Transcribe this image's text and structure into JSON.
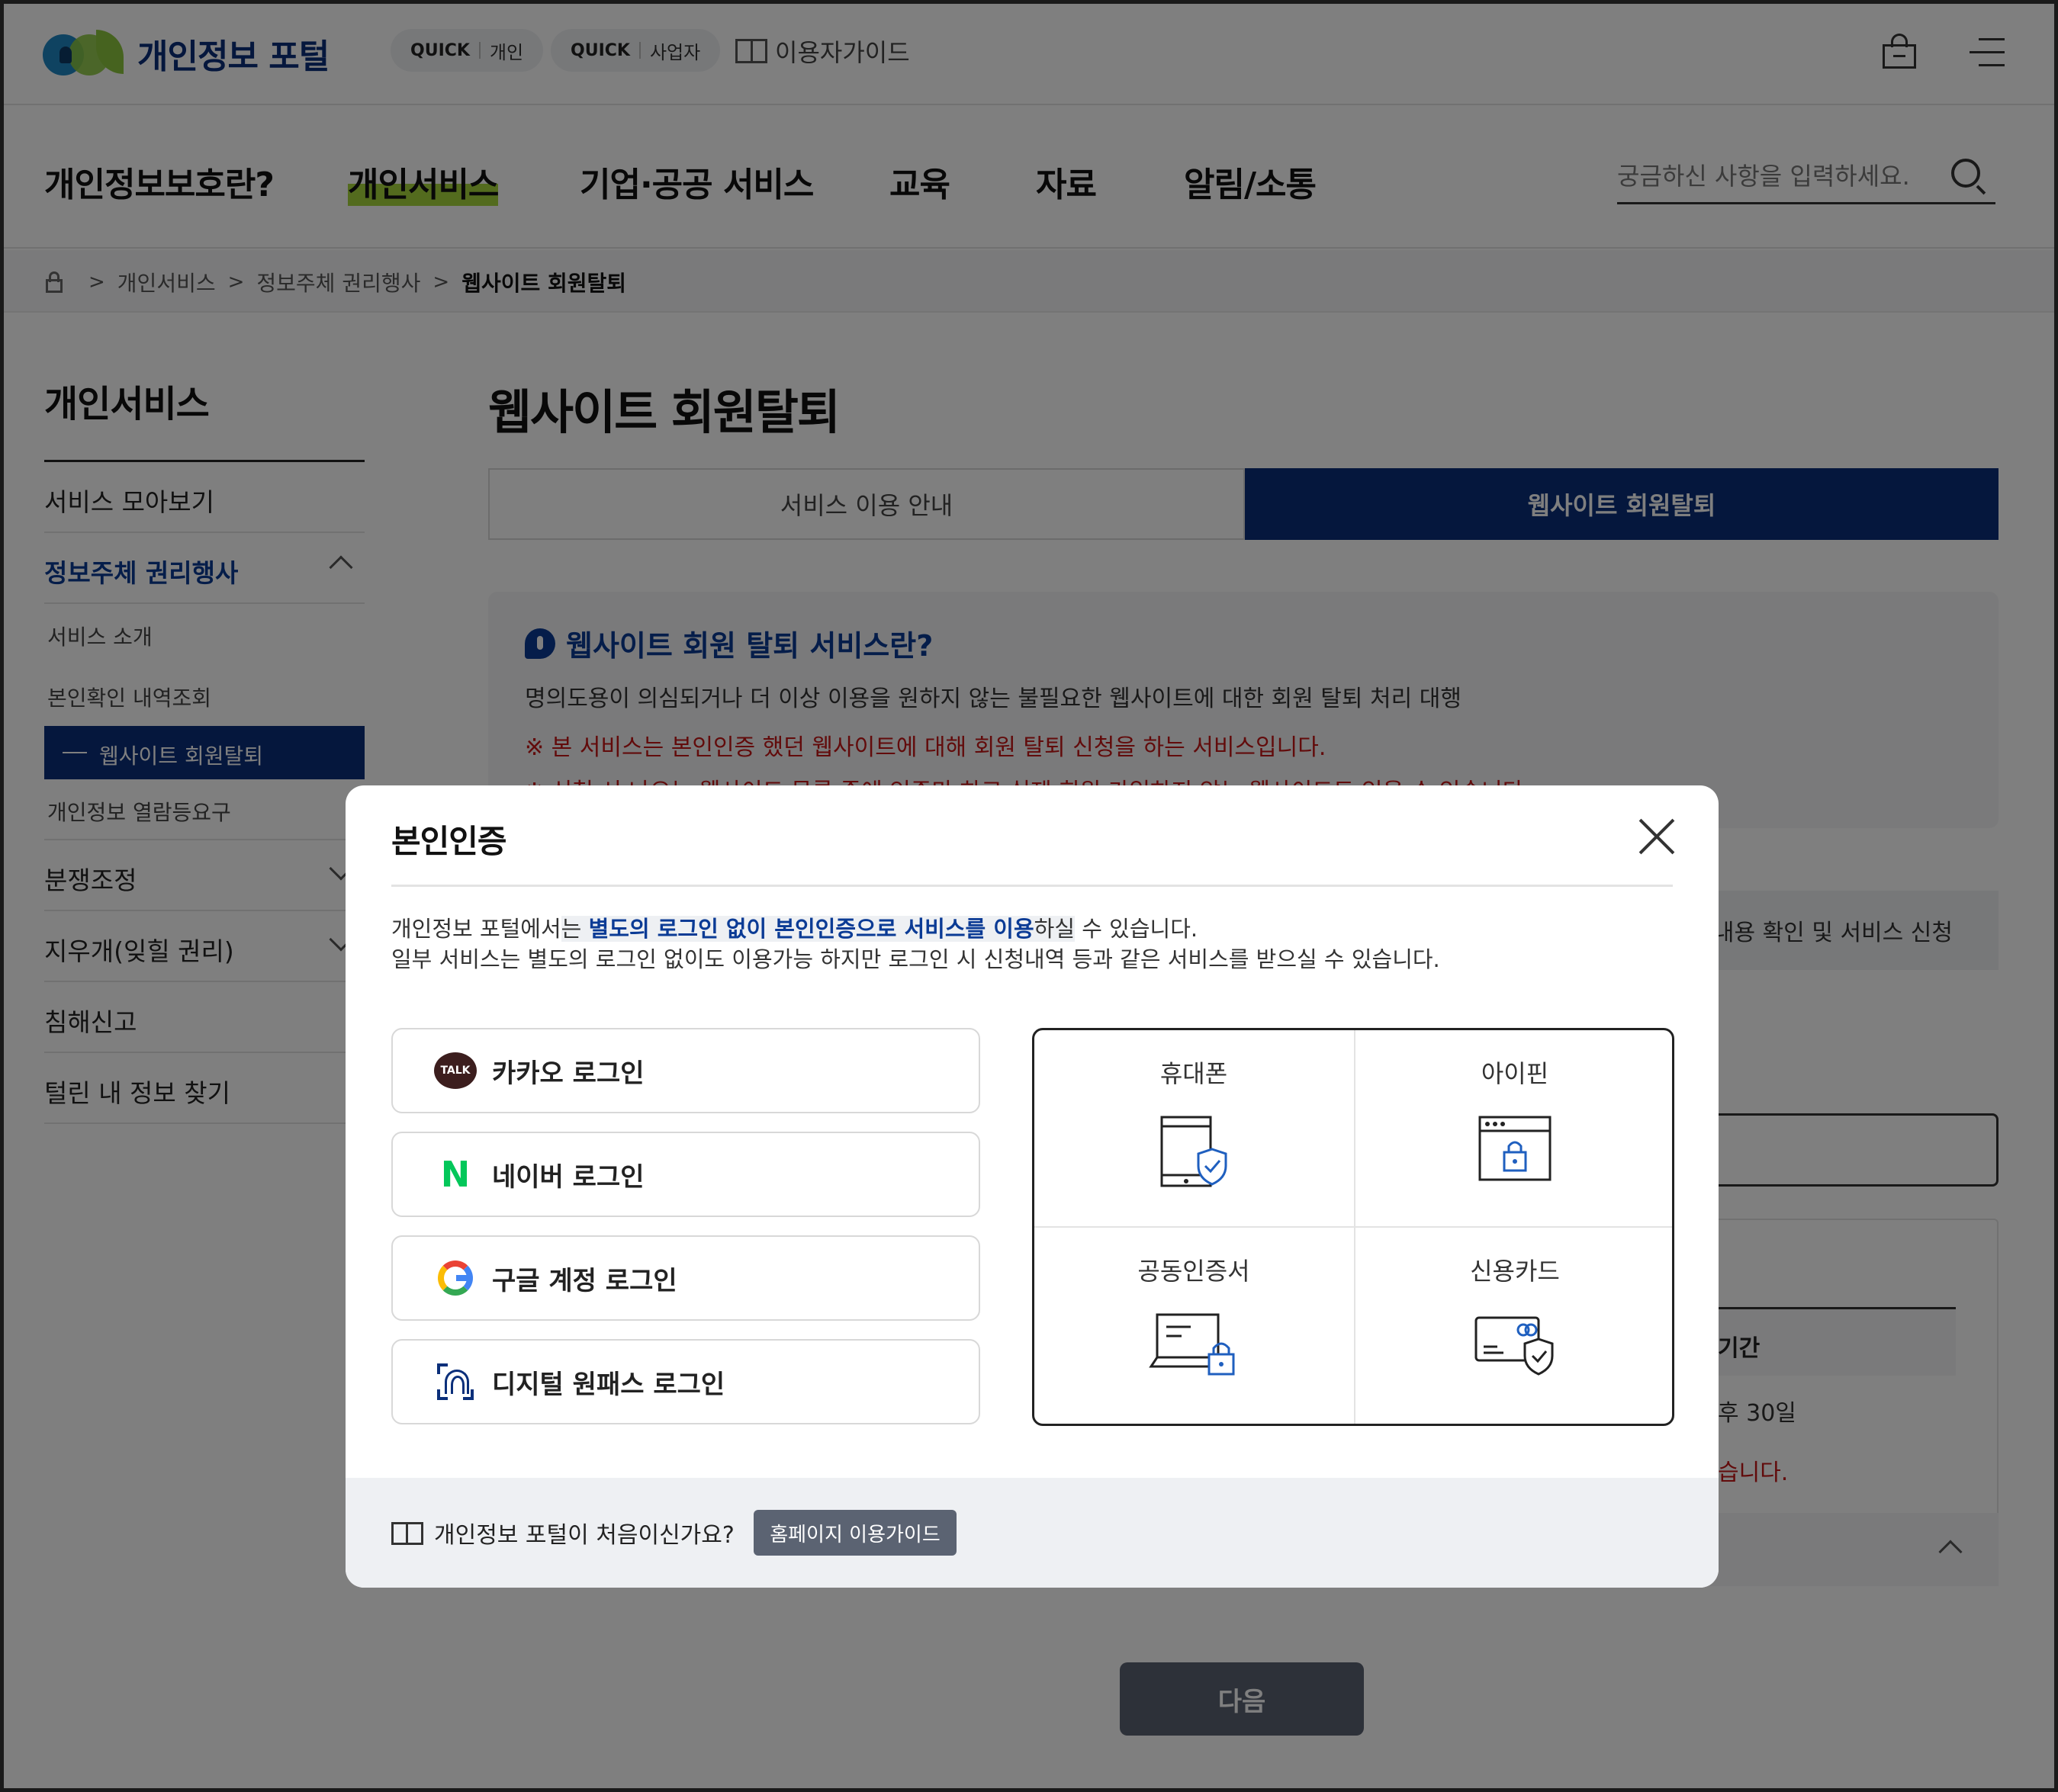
{
  "header": {
    "logo_text": "개인정보 포털",
    "quick_label": "QUICK",
    "quick_personal": "개인",
    "quick_business": "사업자",
    "user_guide": "이용자가이드"
  },
  "gnb": {
    "items": [
      "개인정보보호란?",
      "개인서비스",
      "기업·공공 서비스",
      "교육",
      "자료",
      "알림/소통"
    ],
    "search_placeholder": "궁금하신 사항을 입력하세요."
  },
  "breadcrumb": [
    "개인서비스",
    "정보주체 권리행사",
    "웹사이트 회원탈퇴"
  ],
  "lnb": {
    "title": "개인서비스",
    "items": {
      "all": "서비스 모아보기",
      "rights": "정보주체 권리행사",
      "sub_intro": "서비스 소개",
      "sub_history": "본인확인 내역조회",
      "sub_withdraw": "웹사이트 회원탈퇴",
      "sub_request": "개인정보 열람등요구",
      "dispute": "분쟁조정",
      "forget": "지우개(잊힐 권리)",
      "report": "침해신고",
      "leaked": "털린 내 정보 찾기"
    }
  },
  "main": {
    "title": "웹사이트 회원탈퇴",
    "tab_guide": "서비스 이용 안내",
    "tab_withdraw": "웹사이트 회원탈퇴",
    "info_title": "웹사이트 회원 탈퇴 서비스란?",
    "info_desc": "명의도용이 의심되거나 더 이상 이용을 원하지 않는 불필요한 웹사이트에 대한 회원 탈퇴 처리 대행",
    "info_warn1": "※ 본 서비스는 본인인증 했던 웹사이트에 대해 회원 탈퇴 신청을 하는 서비스입니다.",
    "info_warn2": "※ 신청 시 나오는 웹사이트 목록 중에 인증만 하고 실제 회원 가입하지 않는 웹사이트도 있을 수 있습니다.",
    "step_label": "내용 확인 및 서비스 신청",
    "table_head": "기간",
    "table_cell": "후 30일",
    "table_warn": "습니다.",
    "next": "다음"
  },
  "modal": {
    "title": "본인인증",
    "desc_pre": "개인정보 포털에서",
    "desc_hl_pre": "는 ",
    "desc_hl_blue": "별도의 로그인 없이 본인인증으로 서비스를 이용",
    "desc_hl_post": "하실",
    "desc_post": " 수 있습니다.",
    "desc_line2": "일부 서비스는 별도의 로그인 없이도 이용가능 하지만 로그인 시 신청내역 등과 같은 서비스를 받으실 수 있습니다.",
    "kakao_icon_text": "TALK",
    "naver_icon_text": "N",
    "logins": {
      "kakao": "카카오 로그인",
      "naver": "네이버 로그인",
      "google": "구글 계정 로그인",
      "onepass": "디지털 원패스 로그인"
    },
    "auth": {
      "phone": "휴대폰",
      "ipin": "아이핀",
      "cert": "공동인증서",
      "card": "신용카드"
    },
    "footer_text": "개인정보 포털이 처음이신가요?",
    "footer_button": "홈페이지 이용가이드"
  },
  "colors": {
    "brand_navy": "#0b2f7a",
    "accent_green": "#a6d63c",
    "warn_red": "#c41717",
    "button_gray": "#5b6372"
  }
}
